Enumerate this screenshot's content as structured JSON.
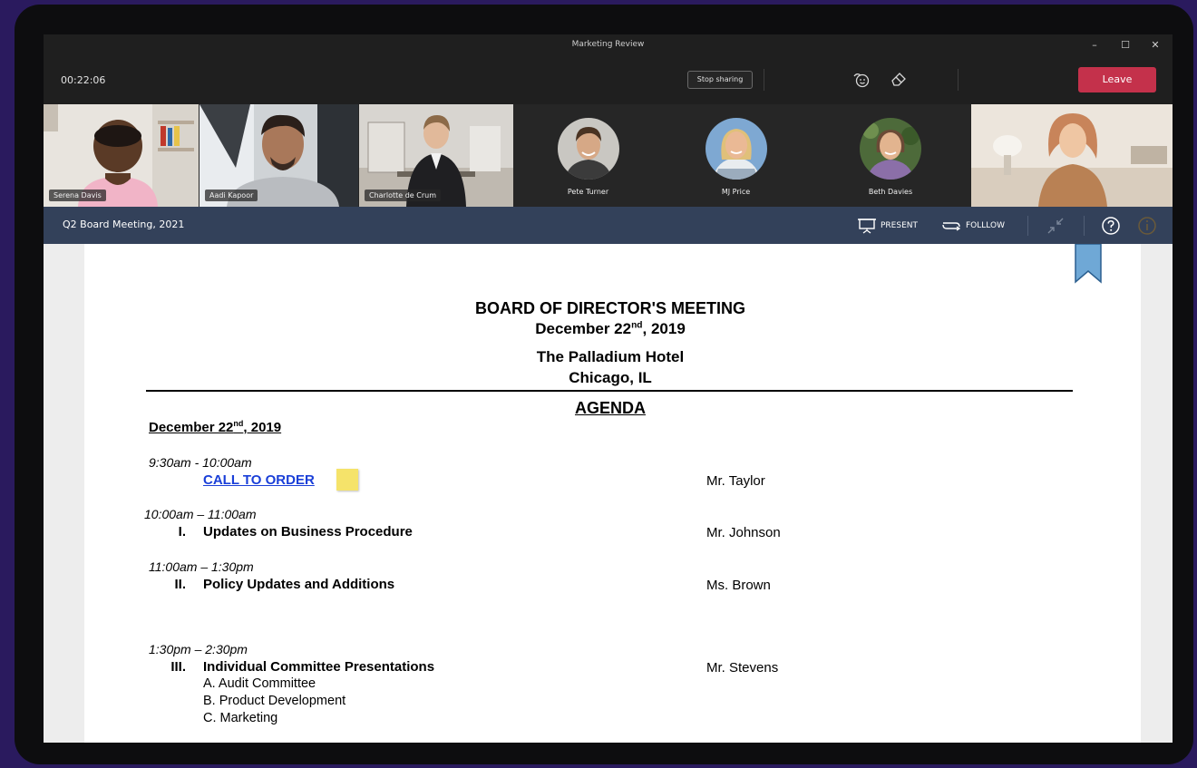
{
  "window": {
    "title": "Marketing Review",
    "minimize_glyph": "–",
    "maximize_glyph": "☐",
    "close_glyph": "✕"
  },
  "toolbar": {
    "timer": "00:22:06",
    "stop_sharing_label": "Stop sharing",
    "leave_label": "Leave",
    "icons": [
      "reactions-icon",
      "eraser-icon"
    ]
  },
  "participants": [
    {
      "name": "Serena Davis",
      "kind": "video"
    },
    {
      "name": "Aadi Kapoor",
      "kind": "video"
    },
    {
      "name": "Charlotte de Crum",
      "kind": "video"
    },
    {
      "name": "Pete Turner",
      "kind": "avatar"
    },
    {
      "name": "MJ Price",
      "kind": "avatar"
    },
    {
      "name": "Beth Davies",
      "kind": "avatar"
    },
    {
      "name": "",
      "kind": "video"
    }
  ],
  "content_bar": {
    "title": "Q2 Board Meeting, 2021",
    "present_label": "PRESENT",
    "follow_label": "FOLLLOW",
    "icons": [
      "present-icon",
      "follow-icon",
      "collapse-icon",
      "help-icon",
      "info-icon"
    ]
  },
  "document": {
    "heading": "BOARD OF DIRECTOR'S MEETING",
    "date_main": "December 22",
    "date_sup": "nd",
    "date_year": ", 2019",
    "venue": "The Palladium Hotel",
    "city": "Chicago, IL",
    "agenda": "AGENDA",
    "agenda_date_main": "December 22",
    "agenda_date_sup": "nd",
    "agenda_date_year": ", 2019",
    "items": [
      {
        "time": "9:30am - 10:00am",
        "number": "",
        "title": "CALL TO ORDER",
        "speaker": "Mr. Taylor"
      },
      {
        "time": "10:00am – 11:00am",
        "number": "I.",
        "title": "Updates on Business Procedure",
        "speaker": "Mr. Johnson"
      },
      {
        "time": "11:00am – 1:30pm",
        "number": "II.",
        "title": "Policy Updates and Additions",
        "speaker": "Ms. Brown"
      },
      {
        "time": "1:30pm – 2:30pm",
        "number": "III.",
        "title": "Individual Committee Presentations",
        "speaker": "Mr. Stevens",
        "subitems": [
          "A. Audit Committee",
          "B. Product Development",
          "C. Marketing"
        ]
      }
    ]
  },
  "colors": {
    "background": "#2a1a5e",
    "leave_button": "#c4314b",
    "content_bar": "#33415a",
    "link": "#1a3fd8",
    "bookmark": "#6fa8d6",
    "sticky_note": "#f5e36a"
  }
}
